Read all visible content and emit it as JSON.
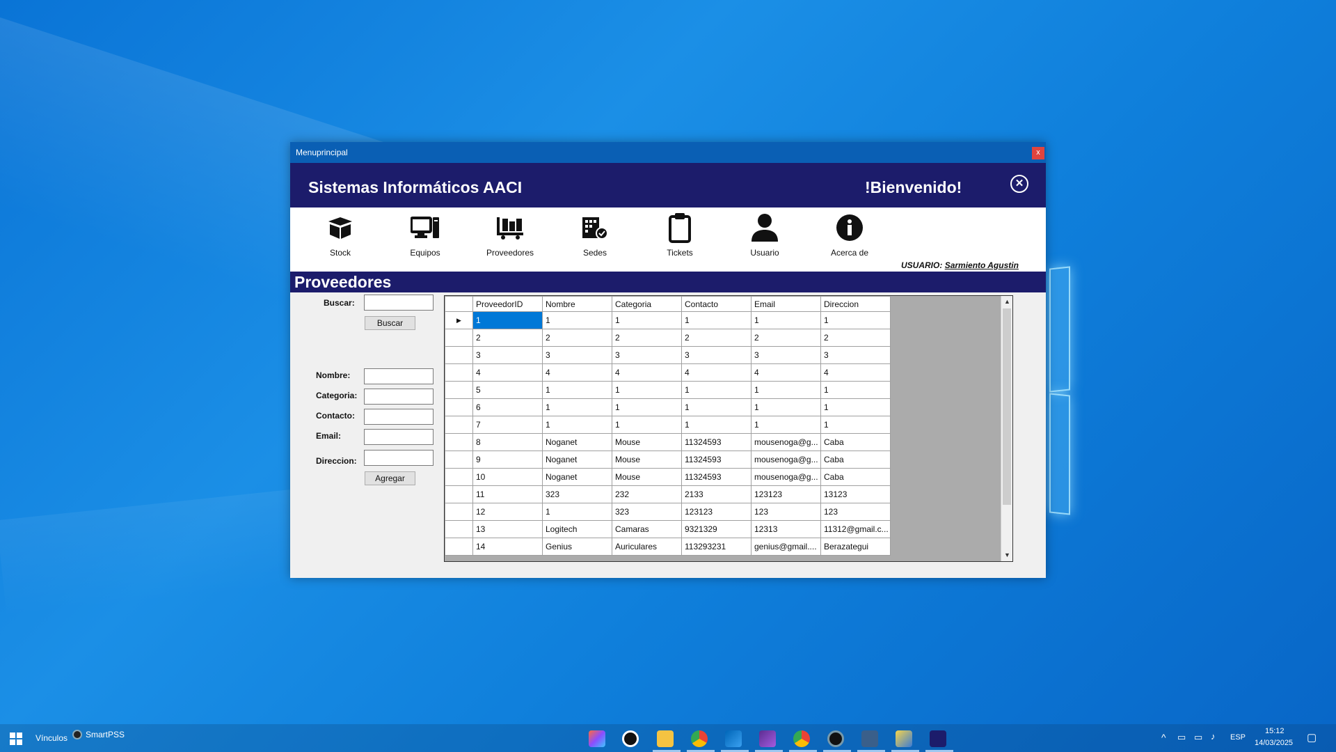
{
  "window": {
    "title": "Menuprincipal",
    "close_glyph": "x",
    "app_title": "Sistemas Informáticos AACI",
    "welcome": "!Bienvenido!",
    "header_close_glyph": "✕"
  },
  "nav": [
    {
      "label": "Stock",
      "icon": "box-icon"
    },
    {
      "label": "Equipos",
      "icon": "computer-icon"
    },
    {
      "label": "Proveedores",
      "icon": "cart-icon"
    },
    {
      "label": "Sedes",
      "icon": "building-icon"
    },
    {
      "label": "Tickets",
      "icon": "clipboard-icon"
    },
    {
      "label": "Usuario",
      "icon": "user-icon"
    },
    {
      "label": "Acerca de",
      "icon": "info-icon"
    }
  ],
  "user": {
    "prefix": "USUARIO:",
    "name": "Sarmiento Agustin"
  },
  "section_title": "Proveedores",
  "form": {
    "search_label": "Buscar:",
    "search_value": "",
    "search_button": "Buscar",
    "nombre_label": "Nombre:",
    "categoria_label": "Categoria:",
    "contacto_label": "Contacto:",
    "email_label": "Email:",
    "direccion_label": "Direccion:",
    "add_button": "Agregar"
  },
  "table": {
    "columns": [
      "ProveedorID",
      "Nombre",
      "Categoria",
      "Contacto",
      "Email",
      "Direccion"
    ],
    "rows": [
      [
        "1",
        "1",
        "1",
        "1",
        "1",
        "1"
      ],
      [
        "2",
        "2",
        "2",
        "2",
        "2",
        "2"
      ],
      [
        "3",
        "3",
        "3",
        "3",
        "3",
        "3"
      ],
      [
        "4",
        "4",
        "4",
        "4",
        "4",
        "4"
      ],
      [
        "5",
        "1",
        "1",
        "1",
        "1",
        "1"
      ],
      [
        "6",
        "1",
        "1",
        "1",
        "1",
        "1"
      ],
      [
        "7",
        "1",
        "1",
        "1",
        "1",
        "1"
      ],
      [
        "8",
        "Noganet",
        "Mouse",
        "11324593",
        "mousenoga@g...",
        "Caba"
      ],
      [
        "9",
        "Noganet",
        "Mouse",
        "11324593",
        "mousenoga@g...",
        "Caba"
      ],
      [
        "10",
        "Noganet",
        "Mouse",
        "11324593",
        "mousenoga@g...",
        "Caba"
      ],
      [
        "11",
        "323",
        "232",
        "2133",
        "123123",
        "13123"
      ],
      [
        "12",
        "1",
        "323",
        "123123",
        "123",
        "123"
      ],
      [
        "13",
        "Logitech",
        "Camaras",
        "9321329",
        "12313",
        "11312@gmail.c..."
      ],
      [
        "14",
        "Genius",
        "Auriculares",
        "113293231",
        "genius@gmail....",
        "Berazategui"
      ]
    ],
    "current_row_marker": "▶"
  },
  "taskbar": {
    "links_label": "Vínculos",
    "smartpss_label": "SmartPSS",
    "lang": "ESP",
    "time": "15:12",
    "date": "14/03/2025"
  }
}
